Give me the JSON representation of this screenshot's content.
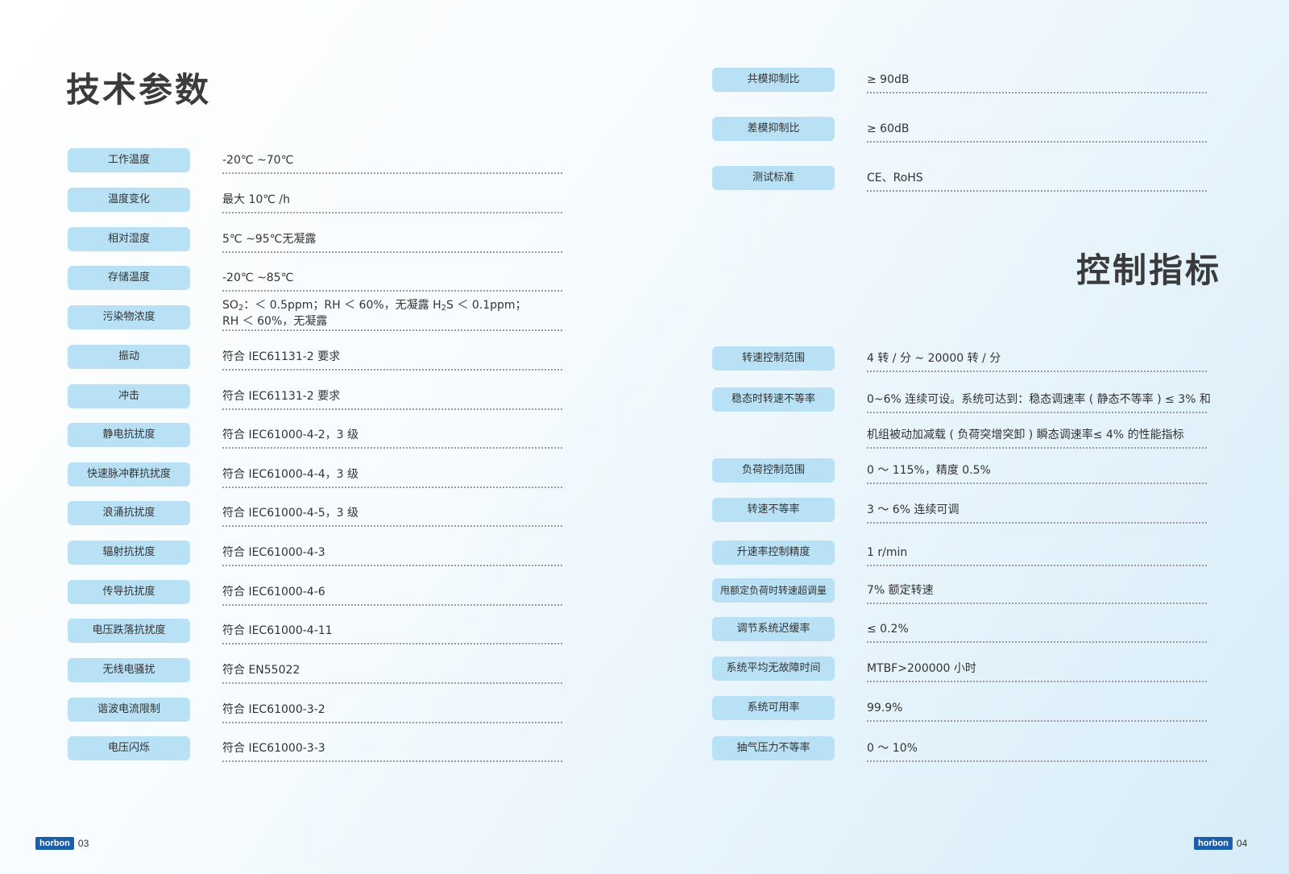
{
  "left": {
    "title": "技术参数",
    "rows": [
      {
        "label": "工作温度",
        "value": "-20℃ ~70℃"
      },
      {
        "label": "温度变化",
        "value": "最大 10℃ /h"
      },
      {
        "label": "相对湿度",
        "value": "5℃ ~95℃无凝露"
      },
      {
        "label": "存储温度",
        "value": "-20℃ ~85℃"
      },
      {
        "label": "污染物浓度",
        "value_line1_a": "SO",
        "value_line1_sub": "2",
        "value_line1_b": "：＜ 0.5ppm；RH ＜ 60%，无凝露 H",
        "value_line1_sub2": "2",
        "value_line1_c": "S ＜ 0.1ppm；",
        "value_line2": "RH ＜ 60%，无凝露"
      },
      {
        "label": "振动",
        "value": "符合 IEC61131-2 要求"
      },
      {
        "label": "冲击",
        "value": "符合 IEC61131-2 要求"
      },
      {
        "label": "静电抗扰度",
        "value": "符合 IEC61000-4-2，3 级"
      },
      {
        "label": "快速脉冲群抗扰度",
        "value": "符合 IEC61000-4-4，3 级"
      },
      {
        "label": "浪涌抗扰度",
        "value": "符合 IEC61000-4-5，3 级"
      },
      {
        "label": "辐射抗扰度",
        "value": "符合 IEC61000-4-3"
      },
      {
        "label": "传导抗扰度",
        "value": "符合 IEC61000-4-6"
      },
      {
        "label": "电压跌落抗扰度",
        "value": "符合 IEC61000-4-11"
      },
      {
        "label": "无线电骚扰",
        "value": "符合 EN55022"
      },
      {
        "label": "谐波电流限制",
        "value": "符合 IEC61000-3-2"
      },
      {
        "label": "电压闪烁",
        "value": "符合 IEC61000-3-3"
      }
    ]
  },
  "right_top": {
    "rows": [
      {
        "label": "共模抑制比",
        "value": "≥ 90dB"
      },
      {
        "label": "差模抑制比",
        "value": "≥ 60dB"
      },
      {
        "label": "测试标准",
        "value": "CE、RoHS"
      }
    ]
  },
  "right": {
    "title": "控制指标",
    "rows": [
      {
        "label": "转速控制范围",
        "value": "4 转 / 分 ~ 20000 转 / 分"
      },
      {
        "label": "稳态时转速不等率",
        "value": "0~6% 连续可设。系统可达到：稳态调速率 ( 静态不等率 ) ≤ 3% 和"
      },
      {
        "label": "",
        "value": "机组被动加减载 ( 负荷突增突卸 ) 瞬态调速率≤ 4% 的性能指标"
      },
      {
        "label": "负荷控制范围",
        "value": "0 ～ 115%，精度 0.5%"
      },
      {
        "label": "转速不等率",
        "value": "3 ～ 6% 连续可调"
      },
      {
        "label": "升速率控制精度",
        "value": "1 r/min"
      },
      {
        "label": "甩额定负荷时转速超调量",
        "value": "7% 额定转速"
      },
      {
        "label": "调节系统迟缓率",
        "value": "≤ 0.2%"
      },
      {
        "label": "系统平均无故障时间",
        "value": "MTBF>200000 小时"
      },
      {
        "label": "系统可用率",
        "value": "99.9%"
      },
      {
        "label": "抽气压力不等率",
        "value": "0 ～ 10%"
      }
    ]
  },
  "footer": {
    "logo_text": "horbon",
    "page_left": "03",
    "page_right": "04"
  }
}
